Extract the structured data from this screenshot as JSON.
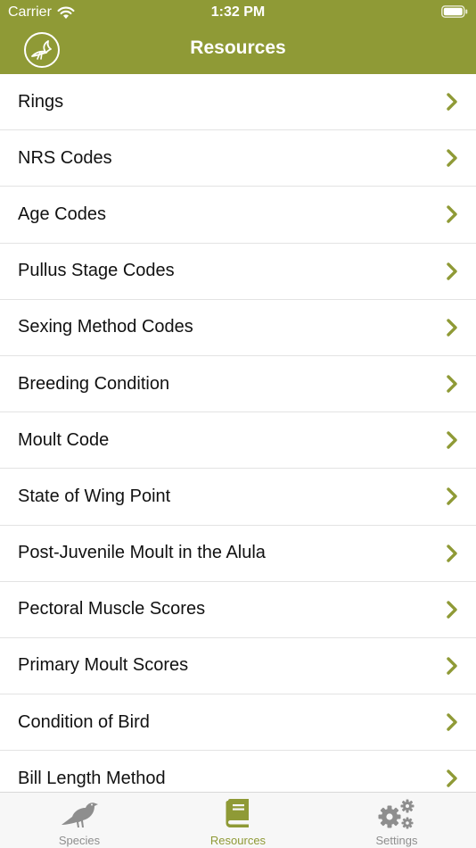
{
  "status_bar": {
    "carrier": "Carrier",
    "time": "1:32 PM"
  },
  "nav": {
    "title": "Resources"
  },
  "resources": [
    {
      "label": "Rings"
    },
    {
      "label": "NRS Codes"
    },
    {
      "label": "Age Codes"
    },
    {
      "label": "Pullus Stage Codes"
    },
    {
      "label": "Sexing Method Codes"
    },
    {
      "label": "Breeding Condition"
    },
    {
      "label": "Moult Code"
    },
    {
      "label": "State of Wing Point"
    },
    {
      "label": "Post-Juvenile Moult in the Alula"
    },
    {
      "label": "Pectoral Muscle Scores"
    },
    {
      "label": "Primary Moult Scores"
    },
    {
      "label": "Condition of Bird"
    },
    {
      "label": "Bill Length Method"
    }
  ],
  "tabs": [
    {
      "label": "Species",
      "icon": "bird-icon",
      "active": false
    },
    {
      "label": "Resources",
      "icon": "book-icon",
      "active": true
    },
    {
      "label": "Settings",
      "icon": "gears-icon",
      "active": false
    }
  ],
  "colors": {
    "accent": "#8f9a36",
    "inactive": "#8e8e8e",
    "tab_bar_bg": "#f7f7f7"
  }
}
